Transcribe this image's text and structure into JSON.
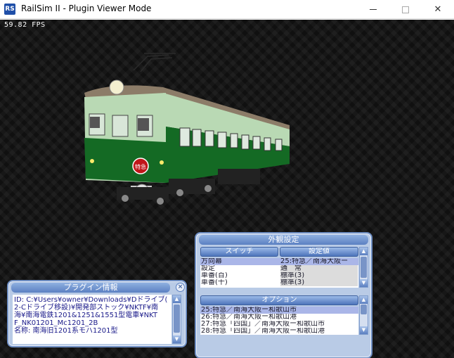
{
  "window": {
    "title": "RailSim II - Plugin Viewer Mode",
    "icon": "railsim-app-icon",
    "icon_glyph": "RS",
    "close_glyph": "✕"
  },
  "viewport": {
    "fps": "59.82 FPS",
    "train_mark_text": "特急",
    "colors": {
      "body_green": "#3f9a55",
      "upper_green": "#b9d9b4",
      "roof": "#8c7c68",
      "lower_dark_green": "#146a24"
    }
  },
  "appearance_panel": {
    "title": "外観設定",
    "switch_header": "スイッチ",
    "value_header": "設定値",
    "rows": [
      {
        "switch": "方向幕",
        "value": "25:特急／南海大阪ー",
        "selected": true
      },
      {
        "switch": "設定",
        "value": "通　常",
        "selected": false
      },
      {
        "switch": "車番(百)",
        "value": "標準(3)",
        "selected": false
      },
      {
        "switch": "車番(十)",
        "value": "標準(3)",
        "selected": false
      }
    ],
    "options_header": "オプション",
    "options": [
      {
        "label": "25:特急／南海大阪ー和歌山市",
        "selected": true
      },
      {
        "label": "26:特急／南海大阪ー和歌山港",
        "selected": false
      },
      {
        "label": "27:特急「四国」／南海大阪ー和歌山市",
        "selected": false
      },
      {
        "label": "28:特急「四国」／南海大阪ー和歌山港",
        "selected": false
      }
    ]
  },
  "plugin_panel": {
    "title": "プラグイン情報",
    "close_glyph": "×",
    "lines": [
      "ID: C:¥Users¥owner¥Downloads¥Dドライブ(",
      "2-Cドライブ移設)¥開発部ストック¥NKTF¥南",
      "海¥南海電鉄1201&1251&1551型電車¥NKT",
      "F_NK01201_Mc1201_2B",
      "名称: 南海旧1201系モハ1201型"
    ]
  },
  "colors": {
    "panel_bg": "#b9cbe6",
    "panel_border": "#6f8fc4",
    "title_bar_blue": "#5b80c2",
    "selected_row": "#aab6e8"
  }
}
